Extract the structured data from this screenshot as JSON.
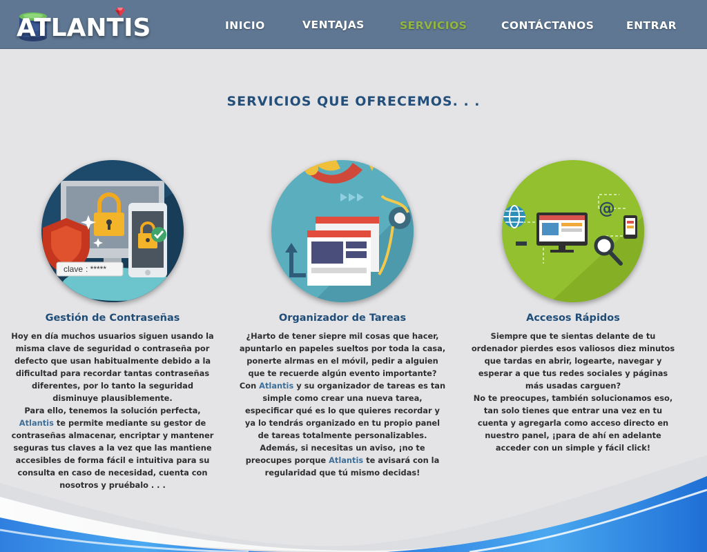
{
  "header": {
    "logo_text": "ATLANTIS",
    "nav": [
      {
        "label": "INICIO",
        "active": false
      },
      {
        "label": "VENTAJAS",
        "active": false
      },
      {
        "label": "SERVICIOS",
        "active": true
      },
      {
        "label": "CONTÁCTANOS",
        "active": false
      },
      {
        "label": "ENTRAR",
        "active": false
      }
    ]
  },
  "main": {
    "title": "SERVICIOS QUE OFRECEMOS. . .",
    "services": [
      {
        "title": "Gestión de Contraseñas",
        "illustration_label": "clave",
        "illustration_value": ": *****",
        "p1": "Hoy en día muchos usuarios siguen usando la misma clave de seguridad o contraseña por defecto que usan habitualmente debido a la dificultad para recordar tantas contraseñas diferentes, por lo tanto la seguridad disminuye plausiblemente.",
        "p2_a": "Para ello, tenemos la solución perfecta, ",
        "p2_brand": "Atlantis",
        "p2_b": " te permite mediante su gestor de contraseñas almacenar, encriptar y mantener seguras tus claves a la vez que las mantiene accesibles de forma fácil e intuitiva para su consulta en caso de necesidad, cuenta con nosotros y pruébalo . . ."
      },
      {
        "title": "Organizador de Tareas",
        "p1": "¿Harto de tener siepre mil cosas que hacer, apuntarlo en papeles sueltos por toda la casa, ponerte alrmas en el móvil, pedir a alguien que te recuerde algún evento importante?",
        "p2_a": "Con ",
        "p2_brand": "Atlantis",
        "p2_b": " y su organizador de tareas es tan simple como crear una nueva tarea, especificar qué es lo que quieres recordar y ya lo tendrás organizado en tu propio panel de tareas totalmente personalizables.",
        "p3_a": "Además, si necesitas un aviso, ¡no te preocupes porque ",
        "p3_brand": "Atlantis",
        "p3_b": " te avisará con la regularidad que tú mismo decidas!"
      },
      {
        "title": "Accesos Rápidos",
        "p1": "Siempre que te sientas delante de tu ordenador pierdes esos valiosos diez minutos que tardas en abrir, logearte, navegar y esperar a que tus redes sociales y páginas más usadas carguen?",
        "p2": "No te preocupes, también solucionamos eso, tan solo tienes que entrar una vez en tu cuenta y agregarla como acceso directo en nuestro panel, ¡para de ahí en adelante acceder con un simple y fácil click!"
      }
    ]
  },
  "colors": {
    "header_bg": "#5f7792",
    "nav_active": "#93b642",
    "title": "#234f7a",
    "brand_link": "#3d6f99",
    "page_bg": "#e4e4e6"
  },
  "icons": [
    "database-logo-icon",
    "gem-icon",
    "padlock-icon",
    "shield-icon",
    "checkmark-icon",
    "gear-icon",
    "globe-icon",
    "at-sign-icon",
    "magnifier-icon",
    "phone-icon"
  ]
}
